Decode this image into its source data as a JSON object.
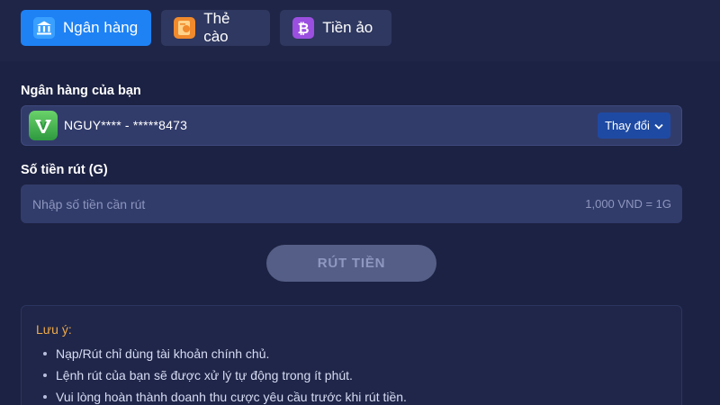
{
  "tabs": [
    {
      "label": "Ngân hàng",
      "icon": "bank-icon",
      "active": true
    },
    {
      "label": "Thẻ cào",
      "icon": "scratch-card-icon",
      "active": false
    },
    {
      "label": "Tiền ảo",
      "icon": "bitcoin-icon",
      "active": false
    }
  ],
  "bank": {
    "label": "Ngân hàng của bạn",
    "account": "NGUY**** - *****8473",
    "logo_icon": "vietcombank-logo-icon",
    "change_label": "Thay đổi"
  },
  "amount": {
    "label": "Số tiền rút (G)",
    "placeholder": "Nhập số tiền cần rút",
    "value": "",
    "rate": "1,000 VND = 1G"
  },
  "submit_label": "RÚT TIỀN",
  "note": {
    "title": "Lưu ý:",
    "items": [
      "Nạp/Rút chỉ dùng tài khoản chính chủ.",
      "Lệnh rút của bạn sẽ được xử lý tự động trong ít phút.",
      "Vui lòng hoàn thành doanh thu cược yêu cầu trước khi rút tiền."
    ]
  },
  "colors": {
    "background": "#1f2547",
    "active_tab": "#1e82f5",
    "input_bg": "#323c6b",
    "note_title": "#f0a94a"
  }
}
